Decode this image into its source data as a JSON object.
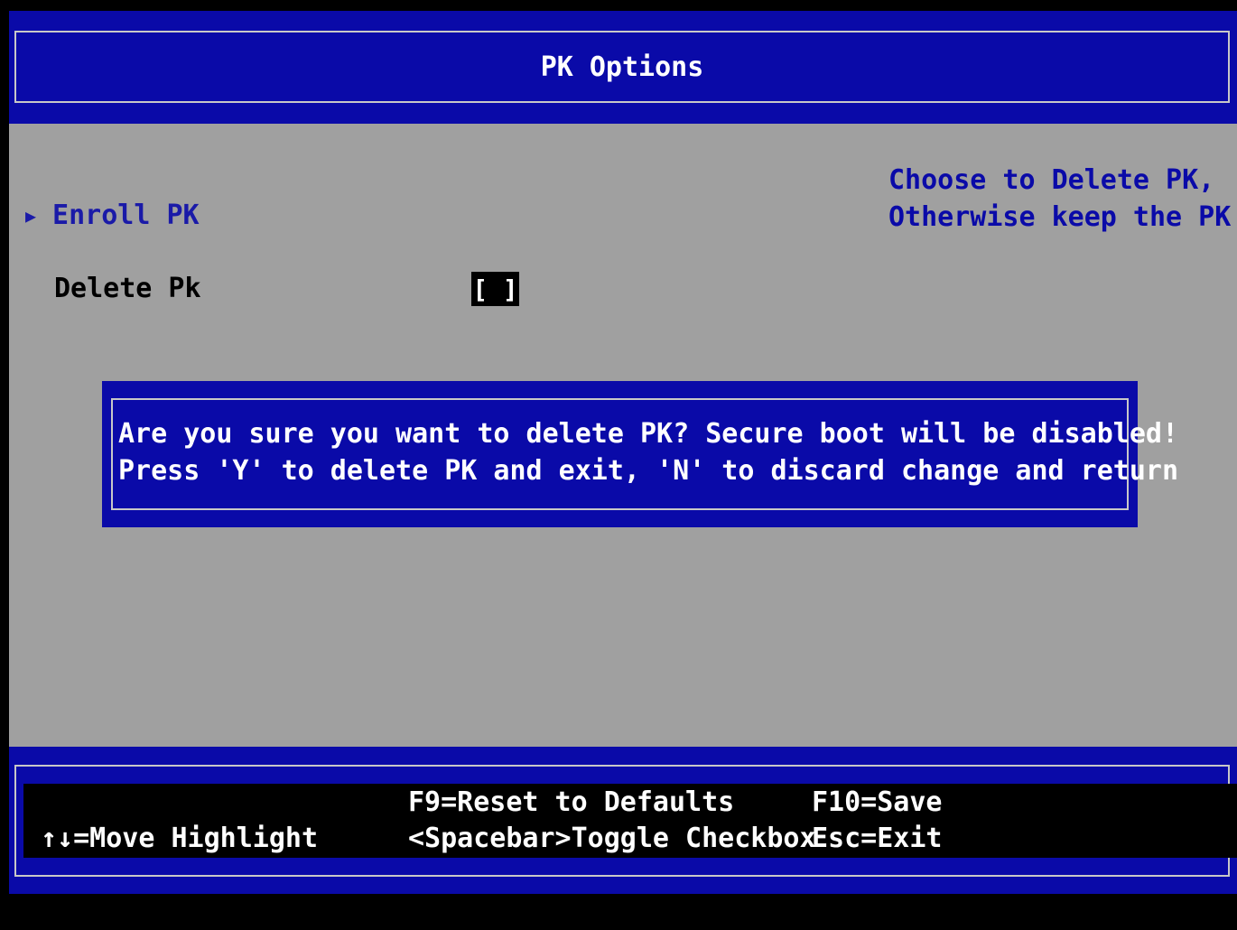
{
  "header": {
    "title": "PK Options"
  },
  "menu": {
    "items": [
      {
        "label": "Enroll PK",
        "icon": "right-triangle-arrow-icon"
      },
      {
        "label": "Delete Pk",
        "value": "[ ]"
      }
    ]
  },
  "help": {
    "line1": "Choose to Delete PK,",
    "line2": "Otherwise keep the PK"
  },
  "dialog": {
    "line1": "Are you sure you want to delete PK? Secure boot will be disabled!",
    "line2": "Press 'Y' to delete PK and exit, 'N' to discard change and return"
  },
  "footer": {
    "move": "↑↓=Move Highlight",
    "reset": "F9=Reset to Defaults",
    "toggle": "<Spacebar>Toggle Checkbox",
    "save": "F10=Save",
    "exit": "Esc=Exit"
  },
  "colors": {
    "blue": "#0a0aa8",
    "gray": "#a0a0a0",
    "help_blue": "#0a0aa8",
    "selection_blue": "#1a1aa8"
  }
}
